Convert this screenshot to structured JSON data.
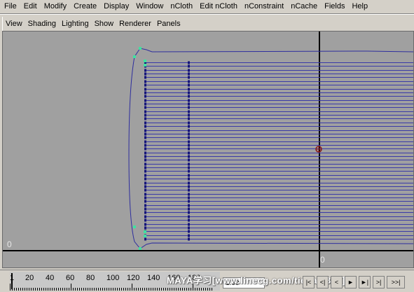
{
  "menubar": {
    "items": [
      "File",
      "Edit",
      "Modify",
      "Create",
      "Display",
      "Window",
      "nCloth",
      "Edit nCloth",
      "nConstraint",
      "nCache",
      "Fields",
      "Help"
    ]
  },
  "panel_menu": {
    "items": [
      "View",
      "Shading",
      "Lighting",
      "Show",
      "Renderer",
      "Panels"
    ]
  },
  "viewport": {
    "origin_label_left": "0",
    "origin_label_right": "0",
    "background_color": "#a0a0a0",
    "curve_color": "#2e2e9e",
    "cv_color": "#1a1a80",
    "handle_color": "#40e0a0"
  },
  "timeline": {
    "tick_labels": [
      "1",
      "20",
      "40",
      "60",
      "80",
      "100",
      "120",
      "140",
      "160",
      "180"
    ],
    "current_frame": "1.00",
    "watermark": "MAYA学习[www.linecg.com/tieba/1800]",
    "playback_buttons": [
      "|<",
      "<|",
      "<",
      "►",
      "►|",
      ">|",
      ">>|"
    ]
  }
}
